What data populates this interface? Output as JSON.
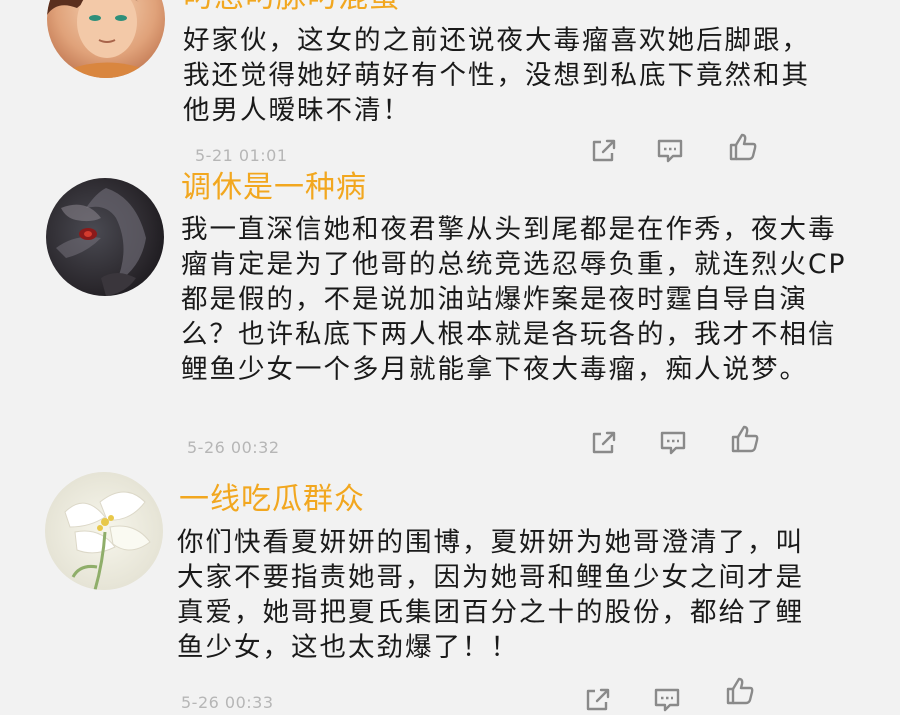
{
  "comments": [
    {
      "username": "叼您叼脉叼混蛋",
      "text": "好家伙，这女的之前还说夜大毒瘤喜欢她后脚跟，我还觉得她好萌好有个性，没想到私底下竟然和其他男人暧昧不清！",
      "time": "5-21 01:01",
      "avatar": "anime-boy-avatar"
    },
    {
      "username": "调休是一种病",
      "text": "我一直深信她和夜君擎从头到尾都是在作秀，夜大毒瘤肯定是为了他哥的总统竞选忍辱负重，就连烈火CP都是假的，不是说加油站爆炸案是夜时霆自导自演么？也许私底下两人根本就是各玩各的，我才不相信鲤鱼少女一个多月就能拿下夜大毒瘤，痴人说梦。",
      "time": "5-26 00:32",
      "avatar": "dark-anime-avatar"
    },
    {
      "username": "一线吃瓜群众",
      "text": "你们快看夏妍妍的围博，夏妍妍为她哥澄清了，叫大家不要指责她哥，因为她哥和鲤鱼少女之间才是真爱，她哥把夏氏集团百分之十的股份，都给了鲤鱼少女，这也太劲爆了！！",
      "time": "5-26 00:33",
      "avatar": "lily-flower-avatar"
    }
  ],
  "colors": {
    "background": "#f2f2f2",
    "username": "#f2a71f",
    "text": "#1a1a1a",
    "meta": "#b6b6b6",
    "icon": "#8a8a8a"
  },
  "icons": {
    "share": "share-icon",
    "reply": "reply-icon",
    "like": "thumbs-up-icon"
  }
}
